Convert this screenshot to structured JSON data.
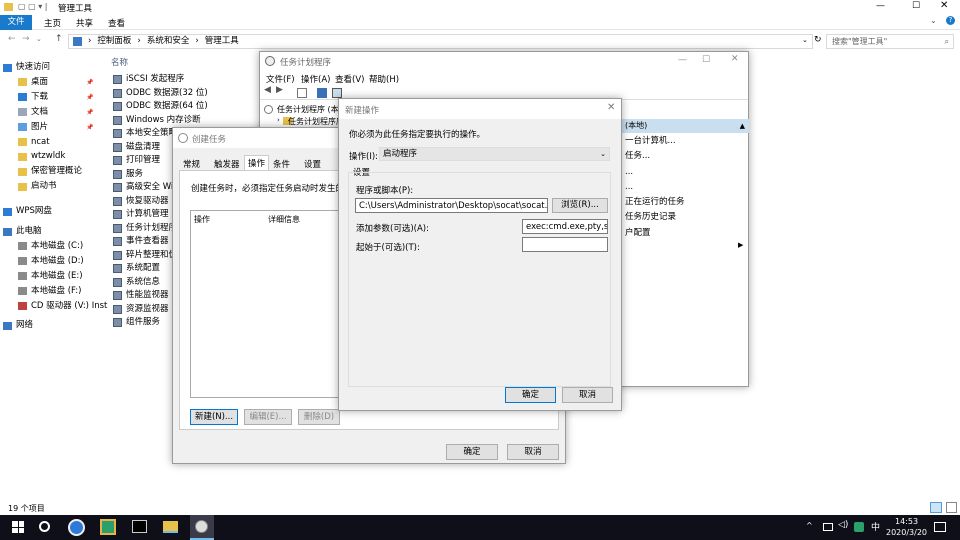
{
  "explorer": {
    "title": "管理工具",
    "ribbon_tabs": [
      "文件",
      "主页",
      "共享",
      "查看"
    ],
    "breadcrumb": [
      "控制面板",
      "系统和安全",
      "管理工具"
    ],
    "search_placeholder": "搜索\"管理工具\"",
    "column_name": "名称",
    "status": "19 个项目",
    "nav": [
      {
        "label": "快速访问",
        "icon": "star-icon",
        "level": 0
      },
      {
        "label": "桌面",
        "icon": "folder-icon",
        "level": 1,
        "pin": true
      },
      {
        "label": "下载",
        "icon": "download-icon",
        "level": 1,
        "pin": true
      },
      {
        "label": "文档",
        "icon": "document-icon",
        "level": 1,
        "pin": true
      },
      {
        "label": "图片",
        "icon": "picture-icon",
        "level": 1,
        "pin": true
      },
      {
        "label": "ncat",
        "icon": "folder-icon",
        "level": 1
      },
      {
        "label": "wtzwldk",
        "icon": "folder-icon",
        "level": 1
      },
      {
        "label": "保密管理概论",
        "icon": "folder-icon",
        "level": 1
      },
      {
        "label": "启动书",
        "icon": "folder-icon",
        "level": 1
      },
      {
        "label": "WPS网盘",
        "icon": "cloud-icon",
        "level": 0
      },
      {
        "label": "此电脑",
        "icon": "computer-icon",
        "level": 0
      },
      {
        "label": "本地磁盘 (C:)",
        "icon": "drive-icon",
        "level": 1
      },
      {
        "label": "本地磁盘 (D:)",
        "icon": "drive-icon",
        "level": 1
      },
      {
        "label": "本地磁盘 (E:)",
        "icon": "drive-icon",
        "level": 1
      },
      {
        "label": "本地磁盘 (F:)",
        "icon": "drive-icon",
        "level": 1
      },
      {
        "label": "CD 驱动器 (V:) Inst",
        "icon": "cd-icon",
        "level": 1
      },
      {
        "label": "网络",
        "icon": "network-icon",
        "level": 0
      }
    ],
    "files": [
      "iSCSI 发起程序",
      "ODBC 数据源(32 位)",
      "ODBC 数据源(64 位)",
      "Windows 内存诊断",
      "本地安全策略",
      "磁盘清理",
      "打印管理",
      "服务",
      "高级安全 Windows",
      "恢复驱动器",
      "计算机管理",
      "任务计划程序",
      "事件查看器",
      "碎片整理和优化",
      "系统配置",
      "系统信息",
      "性能监视器",
      "资源监视器",
      "组件服务"
    ]
  },
  "scheduler": {
    "title": "任务计划程序",
    "menu": [
      "文件(F)",
      "操作(A)",
      "查看(V)",
      "帮助(H)"
    ],
    "tree_root": "任务计划程序 (本地)",
    "tree_child": "任务计划程序库",
    "actions_header": "(本地)",
    "actions": [
      "一台计算机...",
      "任务...",
      "...",
      "...",
      "正在运行的任务",
      "任务历史记录",
      "户配置"
    ]
  },
  "create_task": {
    "title": "创建任务",
    "tabs": [
      "常规",
      "触发器",
      "操作",
      "条件",
      "设置"
    ],
    "description": "创建任务时，必须指定任务启动时发生的操作",
    "col_action": "操作",
    "col_detail": "详细信息",
    "btn_new": "新建(N)...",
    "btn_edit": "编辑(E)...",
    "btn_delete": "删除(D)",
    "btn_ok": "确定",
    "btn_cancel": "取消"
  },
  "new_action": {
    "title": "新建操作",
    "instruction": "你必须为此任务指定要执行的操作。",
    "action_label": "操作(I):",
    "action_value": "启动程序",
    "settings_label": "设置",
    "program_label": "程序或脚本(P):",
    "program_value": "C:\\Users\\Administrator\\Desktop\\socat\\socat.exe",
    "browse": "浏览(R)...",
    "args_label": "添加参数(可选)(A):",
    "args_value": "exec:cmd.exe,pty,stderr",
    "startin_label": "起始于(可选)(T):",
    "startin_value": "",
    "ok": "确定",
    "cancel": "取消"
  },
  "taskbar": {
    "time": "14:53",
    "date": "2020/3/20",
    "ime": "中"
  }
}
